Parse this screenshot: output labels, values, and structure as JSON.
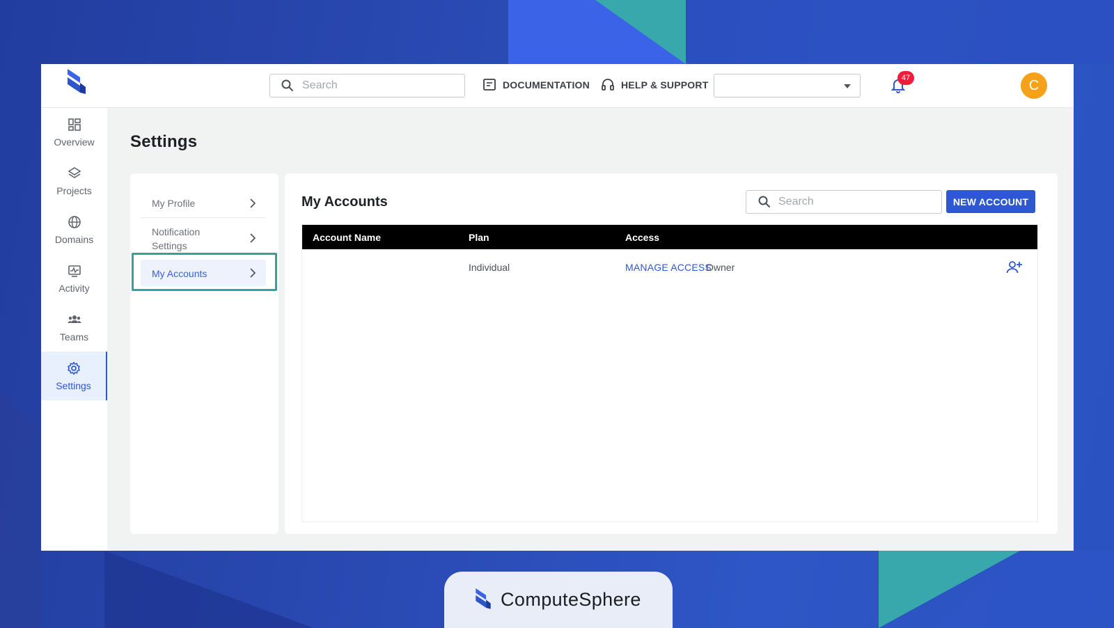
{
  "topbar": {
    "search_placeholder": "Search",
    "documentation_label": "DOCUMENTATION",
    "help_label": "HELP & SUPPORT",
    "org_select_value": "",
    "notification_count": "47",
    "avatar_initial": "C"
  },
  "sidebar": {
    "items": [
      {
        "label": "Overview",
        "icon": "grid-icon"
      },
      {
        "label": "Projects",
        "icon": "layers-icon"
      },
      {
        "label": "Domains",
        "icon": "globe-icon"
      },
      {
        "label": "Activity",
        "icon": "activity-icon"
      },
      {
        "label": "Teams",
        "icon": "users-icon"
      },
      {
        "label": "Settings",
        "icon": "gear-icon",
        "active": true
      }
    ]
  },
  "page": {
    "title": "Settings"
  },
  "submenu": {
    "items": [
      {
        "label": "My Profile"
      },
      {
        "label_line1": "Notification",
        "label_line2": "Settings"
      },
      {
        "label": "My Accounts",
        "active": true
      }
    ]
  },
  "accounts": {
    "title": "My Accounts",
    "search_placeholder": "Search",
    "new_button": "NEW ACCOUNT",
    "columns": [
      "Account Name",
      "Plan",
      "Access"
    ],
    "rows": [
      {
        "account_name": "",
        "plan": "Individual",
        "manage_label": "MANAGE ACCESS",
        "role": "Owner"
      }
    ]
  },
  "brand": {
    "name": "ComputeSphere"
  },
  "colors": {
    "primary": "#2d57d3",
    "highlight": "#2fa3a0",
    "badge": "#ef1d3a",
    "avatar": "#f5a21a"
  }
}
